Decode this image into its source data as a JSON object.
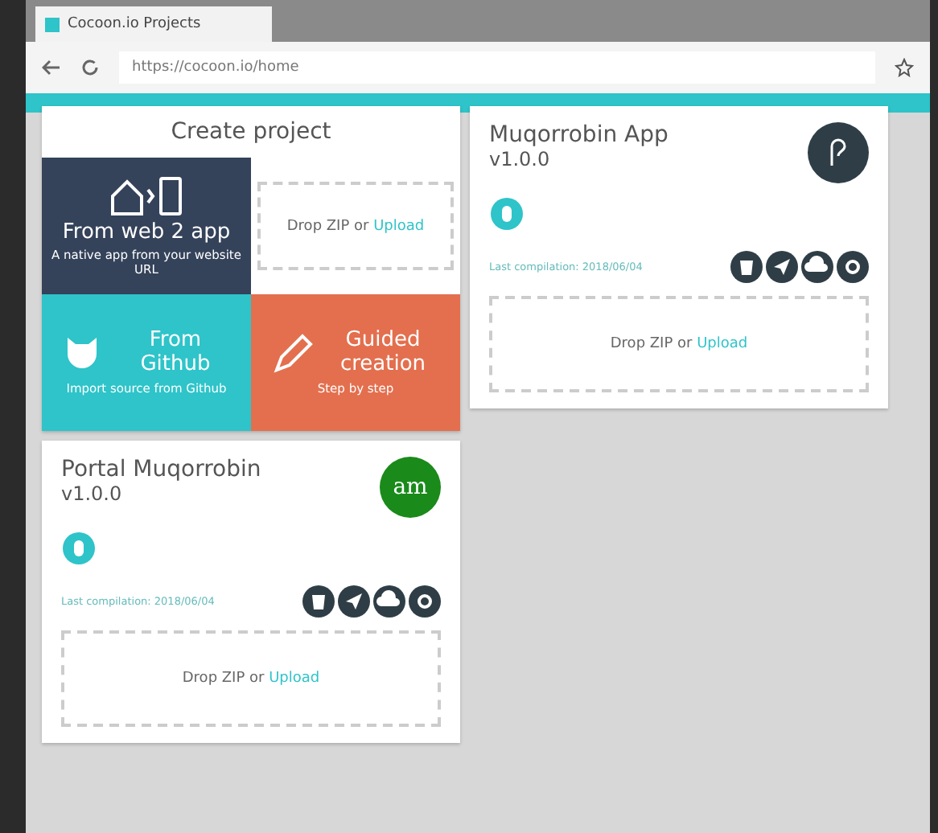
{
  "browser": {
    "tab_title": "Cocoon.io Projects",
    "url": "https://cocoon.io/home"
  },
  "create_project": {
    "title": "Create project",
    "tiles": [
      {
        "kind": "web2app",
        "title": "From web 2 app",
        "subtitle": "A native app from your website URL"
      },
      {
        "kind": "drop",
        "text": "Drop ZIP or",
        "link": "Upload"
      },
      {
        "kind": "github",
        "title": "From Github",
        "subtitle": "Import source from Github"
      },
      {
        "kind": "guided",
        "title": "Guided creation",
        "subtitle": "Step by step"
      }
    ]
  },
  "projects": [
    {
      "name": "Muqorrobin App",
      "version": "v1.0.0",
      "last_compilation": "Last compilation: 2018/06/04",
      "drop_text": "Drop ZIP or",
      "drop_link": "Upload",
      "color": "#2f3e46"
    },
    {
      "name": "Portal Muqorrobin",
      "version": "v1.0.0",
      "avatar_text": "am",
      "last_compilation": "Last compilation: 2018/06/04",
      "drop_text": "Drop ZIP or",
      "drop_link": "Upload",
      "color": "#1a8a1a"
    }
  ]
}
